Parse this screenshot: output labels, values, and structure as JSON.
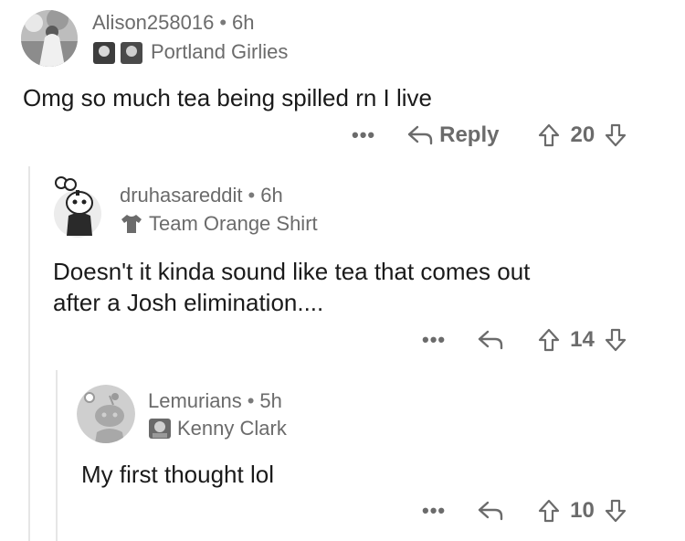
{
  "comments": [
    {
      "username": "Alison258016",
      "time": "6h",
      "flair": "Portland Girlies",
      "body": "Omg so much tea being spilled rn I live",
      "reply_label": "Reply",
      "votes": "20"
    },
    {
      "username": "druhasareddit",
      "time": "6h",
      "flair": "Team Orange Shirt",
      "body_lines": [
        "Doesn't it kinda sound like tea that comes out",
        "after a Josh elimination...."
      ],
      "votes": "14"
    },
    {
      "username": "Lemurians",
      "time": "5h",
      "flair": "Kenny Clark",
      "body": "My first thought lol",
      "votes": "10"
    }
  ],
  "icons": {
    "more": "more-options-icon",
    "reply": "reply-arrow-icon",
    "upvote": "upvote-arrow-icon",
    "downvote": "downvote-arrow-icon"
  },
  "colors": {
    "text": "#1a1a1a",
    "muted": "#6b6b6b",
    "thread": "#e6e6e6"
  }
}
